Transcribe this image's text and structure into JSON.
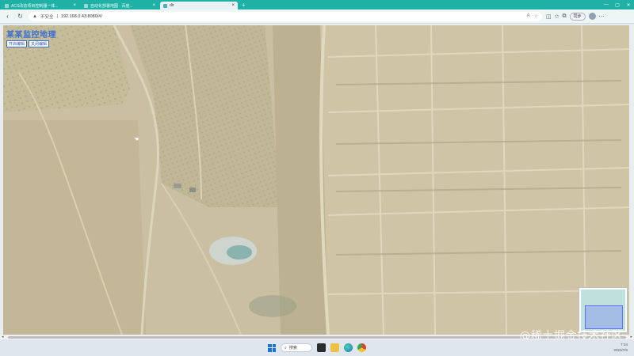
{
  "browser": {
    "tabs": [
      {
        "title": "ACS改造项目控制器一体...",
        "active": false
      },
      {
        "title": "自动化部署地图 - 百度...",
        "active": false
      },
      {
        "title": "dir",
        "active": true
      }
    ],
    "new_tab_label": "+",
    "window_controls": {
      "minimize": "—",
      "maximize": "▢",
      "close": "✕"
    },
    "address": {
      "security_label": "不安全",
      "url": "192.168.0.43:8080/#/"
    },
    "sync_label": "同步"
  },
  "map": {
    "title": "某某监控地理",
    "buttons": [
      "开启编辑",
      "关闭编辑"
    ],
    "overview_visible": true
  },
  "taskbar": {
    "search_label": "搜索",
    "time": "7:34",
    "date": "2023/7/6"
  },
  "watermark": "@稀土掘金技术社区",
  "colors": {
    "tab_strip": "#1fb0a6",
    "map_title": "#3a70d0",
    "terrain": "#bfb493"
  }
}
